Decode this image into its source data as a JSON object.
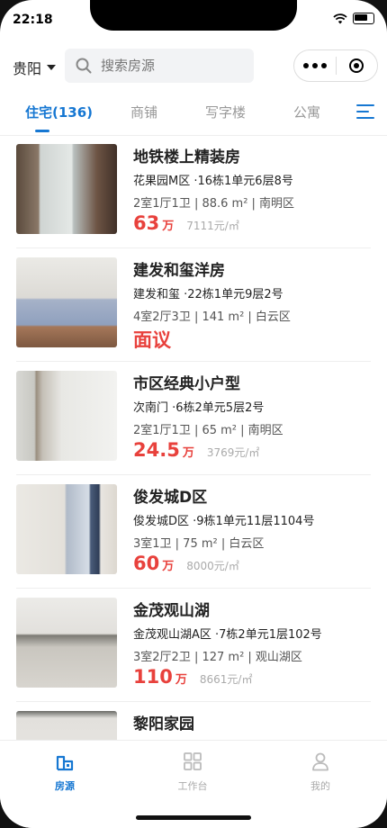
{
  "status": {
    "time": "22:18"
  },
  "topbar": {
    "city": "贵阳",
    "search_placeholder": "搜索房源"
  },
  "tabs": [
    {
      "label": "住宅(136)",
      "active": true
    },
    {
      "label": "商铺"
    },
    {
      "label": "写字楼"
    },
    {
      "label": "公寓"
    }
  ],
  "listings": [
    {
      "title": "地铁楼上精装房",
      "address": "花果园M区 ·16栋1单元6层8号",
      "specs": "2室1厅1卫 | 88.6 m² | 南明区",
      "price": "63",
      "unit": "万",
      "per_sqm": "7111元/㎡"
    },
    {
      "title": "建发和玺洋房",
      "address": "建发和玺 ·22栋1单元9层2号",
      "specs": "4室2厅3卫 | 141 m² | 白云区",
      "price": "面议",
      "unit": "",
      "per_sqm": ""
    },
    {
      "title": "市区经典小户型",
      "address": "次南门 ·6栋2单元5层2号",
      "specs": "2室1厅1卫 | 65 m² | 南明区",
      "price": "24.5",
      "unit": "万",
      "per_sqm": "3769元/㎡"
    },
    {
      "title": "俊发城D区",
      "address": "俊发城D区 ·9栋1单元11层1104号",
      "specs": "3室1卫 | 75 m² | 白云区",
      "price": "60",
      "unit": "万",
      "per_sqm": "8000元/㎡"
    },
    {
      "title": "金茂观山湖",
      "address": "金茂观山湖A区 ·7栋2单元1层102号",
      "specs": "3室2厅2卫 | 127 m² | 观山湖区",
      "price": "110",
      "unit": "万",
      "per_sqm": "8661元/㎡"
    },
    {
      "title": "黎阳家园",
      "address": "",
      "specs": "",
      "price": "",
      "unit": "",
      "per_sqm": ""
    }
  ],
  "tabbar": [
    {
      "label": "房源",
      "icon": "house-icon",
      "active": true
    },
    {
      "label": "工作台",
      "icon": "grid-icon"
    },
    {
      "label": "我的",
      "icon": "person-icon"
    }
  ],
  "colors": {
    "accent": "#1677d2",
    "price": "#e8413c"
  }
}
